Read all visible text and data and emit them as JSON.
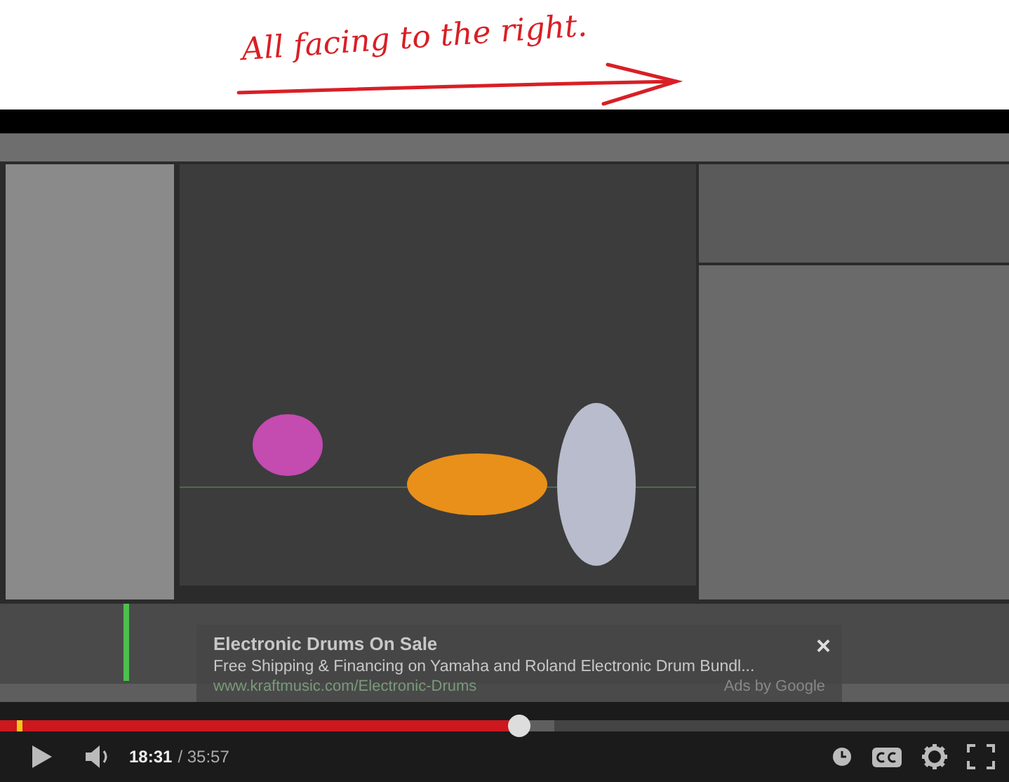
{
  "annotation": {
    "text": "All facing to the right."
  },
  "ad": {
    "title": "Electronic Drums On Sale",
    "description": "Free Shipping & Financing on Yamaha and Roland Electronic Drum Bundl...",
    "url": "www.kraftmusic.com/Electronic-Drums",
    "attribution": "Ads by Google",
    "close": "×"
  },
  "player": {
    "progress": {
      "level": 0.515
    },
    "buffer": {
      "level": 0.55
    },
    "current_time": "18:31",
    "total_time": "/ 35:57",
    "playing": false
  }
}
